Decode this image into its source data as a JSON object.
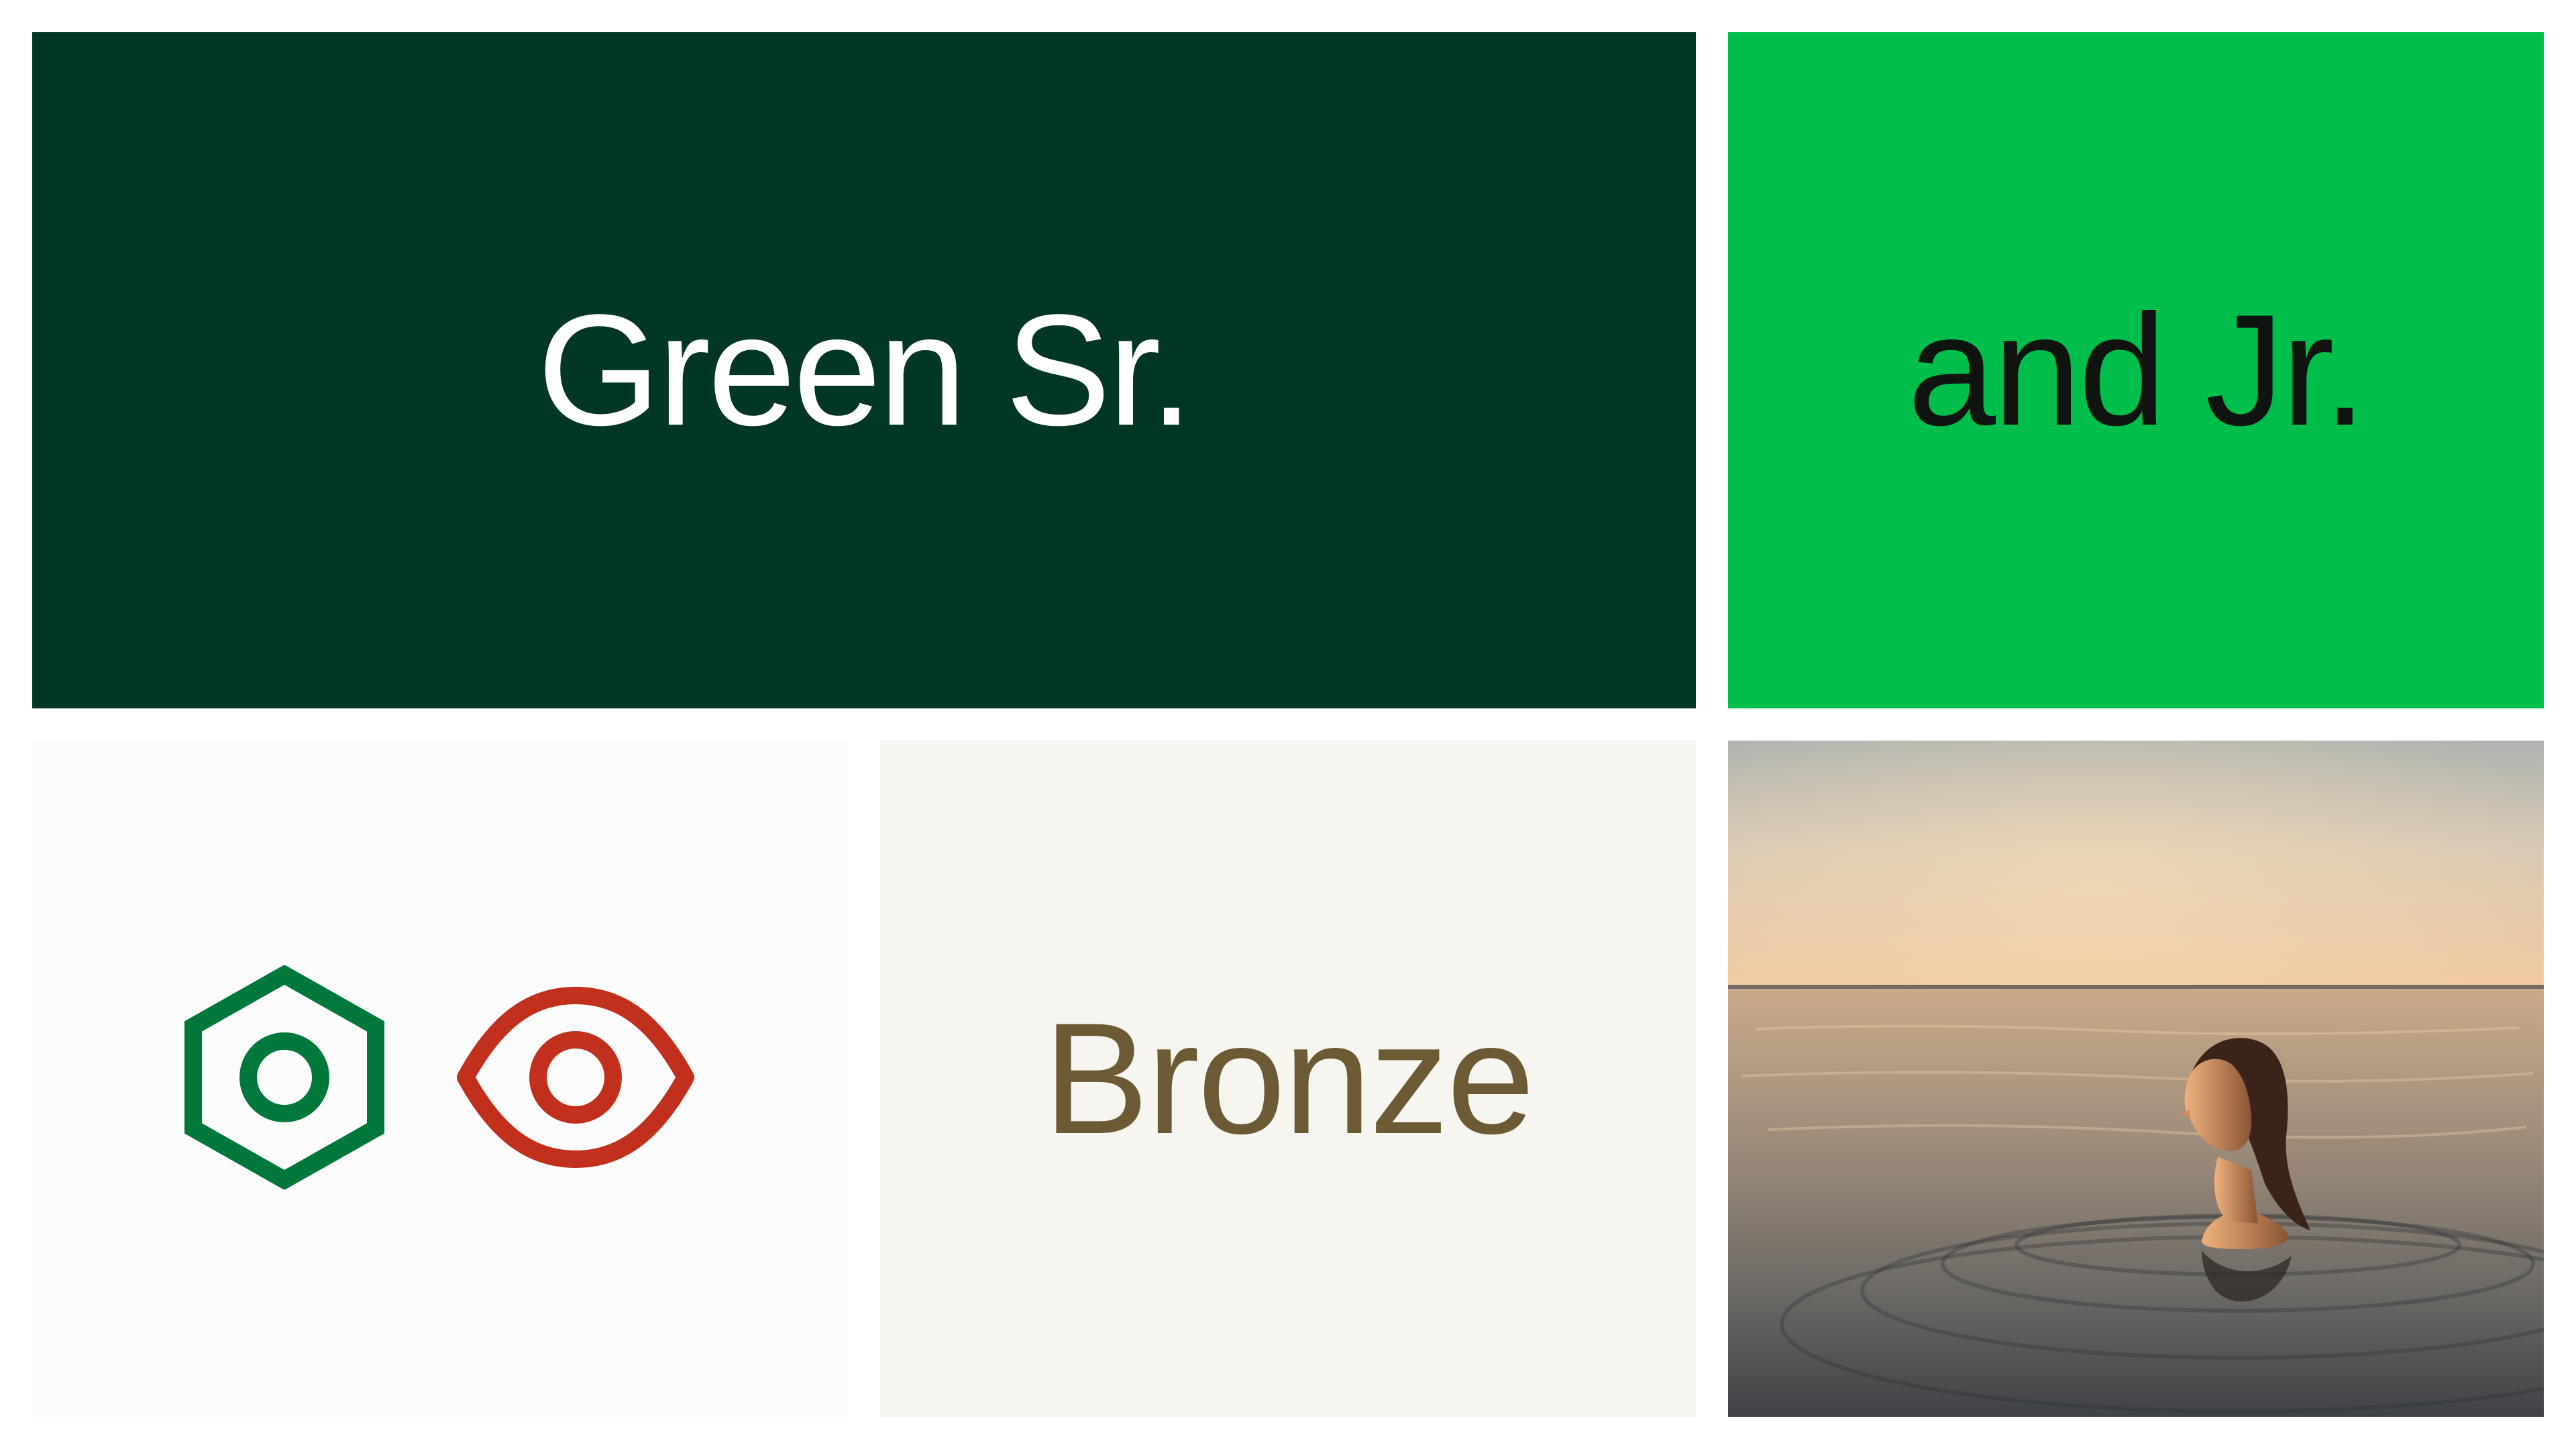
{
  "tiles": {
    "green_sr": {
      "label": "Green Sr."
    },
    "green_jr": {
      "label": "and Jr."
    },
    "bronze": {
      "label": "Bronze"
    }
  },
  "icons": [
    "hexagon-ring-icon",
    "eye-icon"
  ],
  "colors": {
    "page_background": "#ffffff",
    "green_sr": "#023726",
    "green_jr": "#00be4b",
    "icons_tile": "#fbfbfb",
    "bronze_tile": "#f6f5f0",
    "bronze_text": "#6b5a34",
    "hexagon_icon": "#00783b",
    "eye_icon": "#c0301c",
    "dark_text": "#0f1410",
    "light_text": "#ffffff"
  },
  "photo": {
    "subject": "person-swimming-at-sunset"
  }
}
